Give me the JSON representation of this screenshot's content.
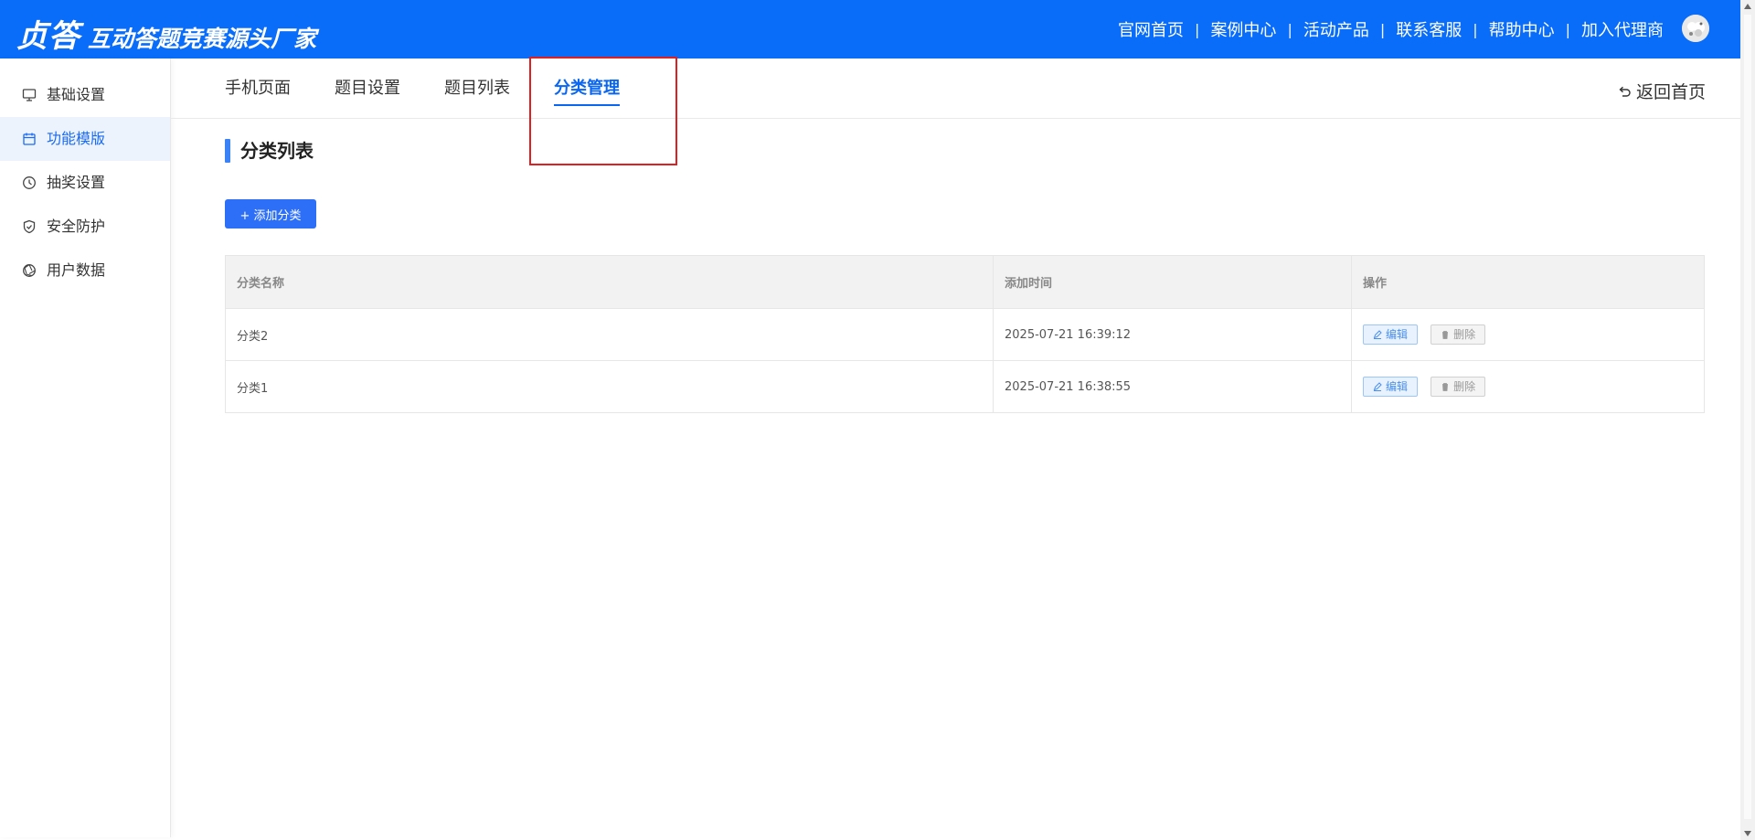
{
  "header": {
    "logo": "贞答",
    "slogan": "互动答题竞赛源头厂家",
    "nav": [
      "官网首页",
      "案例中心",
      "活动产品",
      "联系客服",
      "帮助中心",
      "加入代理商"
    ],
    "separator": "|"
  },
  "sidebar": {
    "items": [
      {
        "label": "基础设置",
        "icon": "monitor-icon",
        "active": false
      },
      {
        "label": "功能模版",
        "icon": "calendar-icon",
        "active": true
      },
      {
        "label": "抽奖设置",
        "icon": "clock-icon",
        "active": false
      },
      {
        "label": "安全防护",
        "icon": "shield-icon",
        "active": false
      },
      {
        "label": "用户数据",
        "icon": "aperture-icon",
        "active": false
      }
    ]
  },
  "tabs": {
    "items": [
      {
        "label": "手机页面",
        "active": false
      },
      {
        "label": "题目设置",
        "active": false
      },
      {
        "label": "题目列表",
        "active": false
      },
      {
        "label": "分类管理",
        "active": true
      }
    ],
    "back_home": "返回首页"
  },
  "main": {
    "section_title": "分类列表",
    "add_button": "+ 添加分类",
    "table": {
      "headers": [
        "分类名称",
        "添加时间",
        "操作"
      ],
      "rows": [
        {
          "name": "分类2",
          "time": "2025-07-21 16:39:12",
          "edit": "编辑",
          "delete": "删除"
        },
        {
          "name": "分类1",
          "time": "2025-07-21 16:38:55",
          "edit": "编辑",
          "delete": "删除"
        }
      ]
    }
  },
  "colors": {
    "brand": "#0a6dfa",
    "active_tab": "#0a66f0",
    "highlight_box": "#e02020"
  }
}
